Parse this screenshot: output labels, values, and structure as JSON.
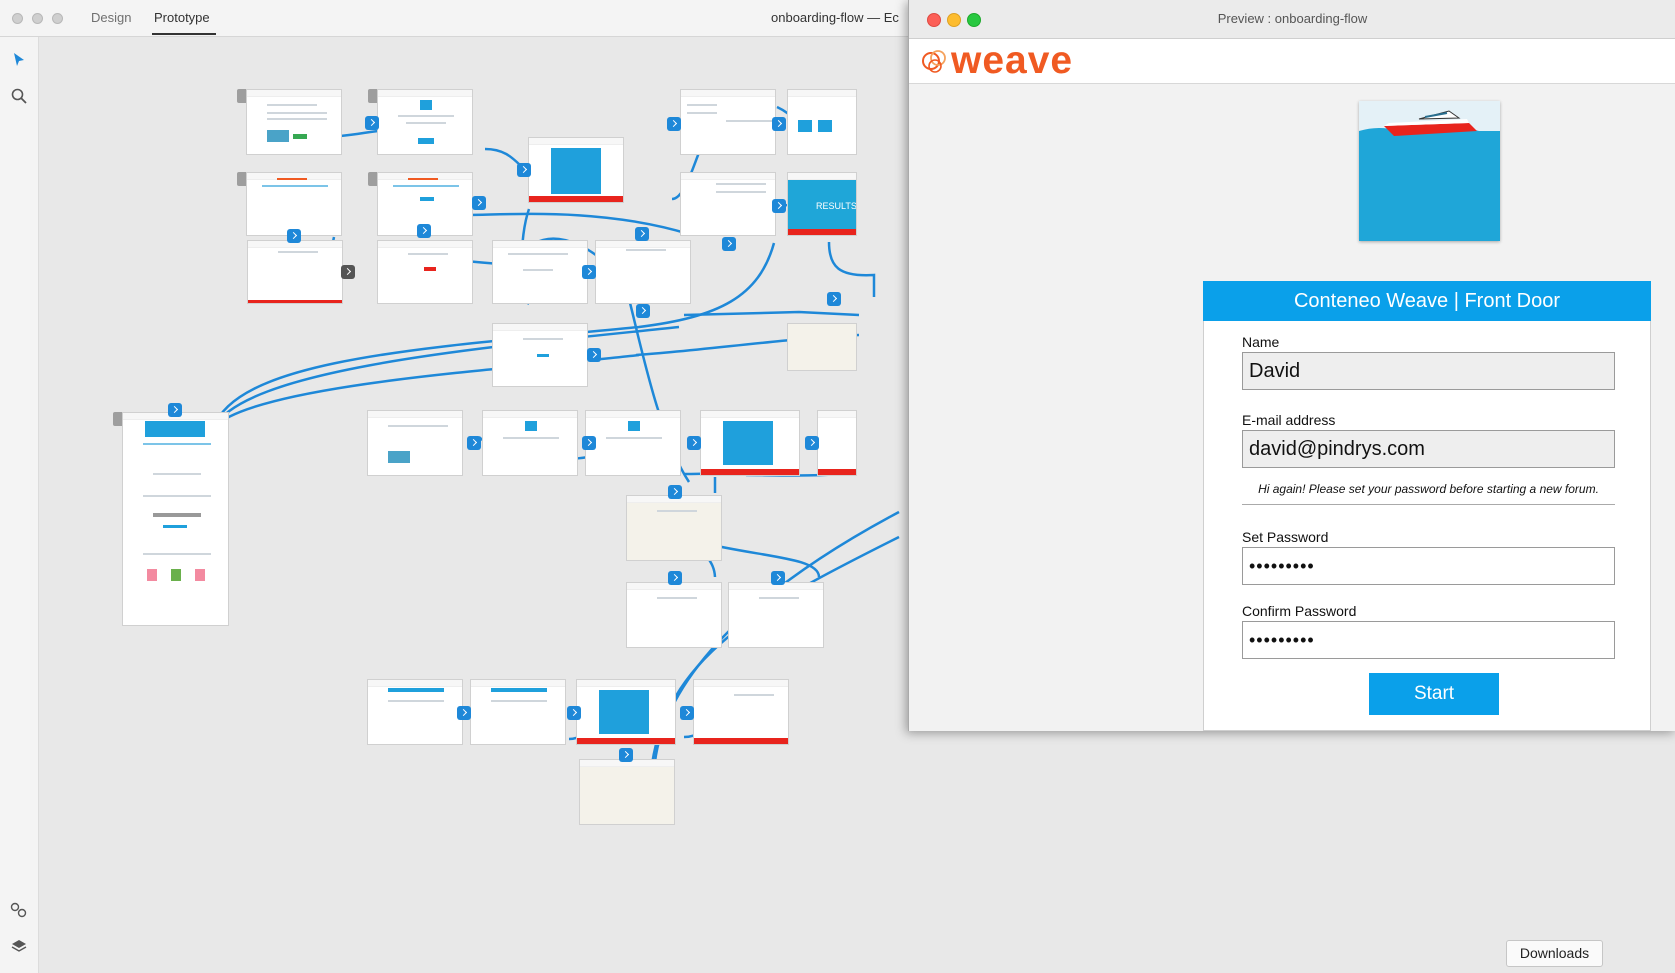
{
  "toolbar": {
    "tabs": [
      {
        "label": "Design"
      },
      {
        "label": "Prototype"
      }
    ],
    "document_title": "onboarding-flow  —  Ec"
  },
  "preview": {
    "window_title": "Preview : onboarding-flow",
    "brand": "weave",
    "form": {
      "heading": "Conteneo Weave | Front Door",
      "name_label": "Name",
      "name_value": "David",
      "email_label": "E-mail address",
      "email_value": "david@pindrys.com",
      "hint": "Hi again! Please set your password before starting a new forum.",
      "set_password_label": "Set Password",
      "set_password_value": "•••••••••",
      "confirm_password_label": "Confirm Password",
      "confirm_password_value": "•••••••••",
      "start_label": "Start"
    }
  },
  "canvas": {
    "results_label": "RESULTS"
  },
  "downloads_label": "Downloads",
  "colors": {
    "accent_blue": "#0aa0ea",
    "wire_blue": "#1e88d8",
    "brand_orange": "#f05a22",
    "error_red": "#e8241d"
  }
}
